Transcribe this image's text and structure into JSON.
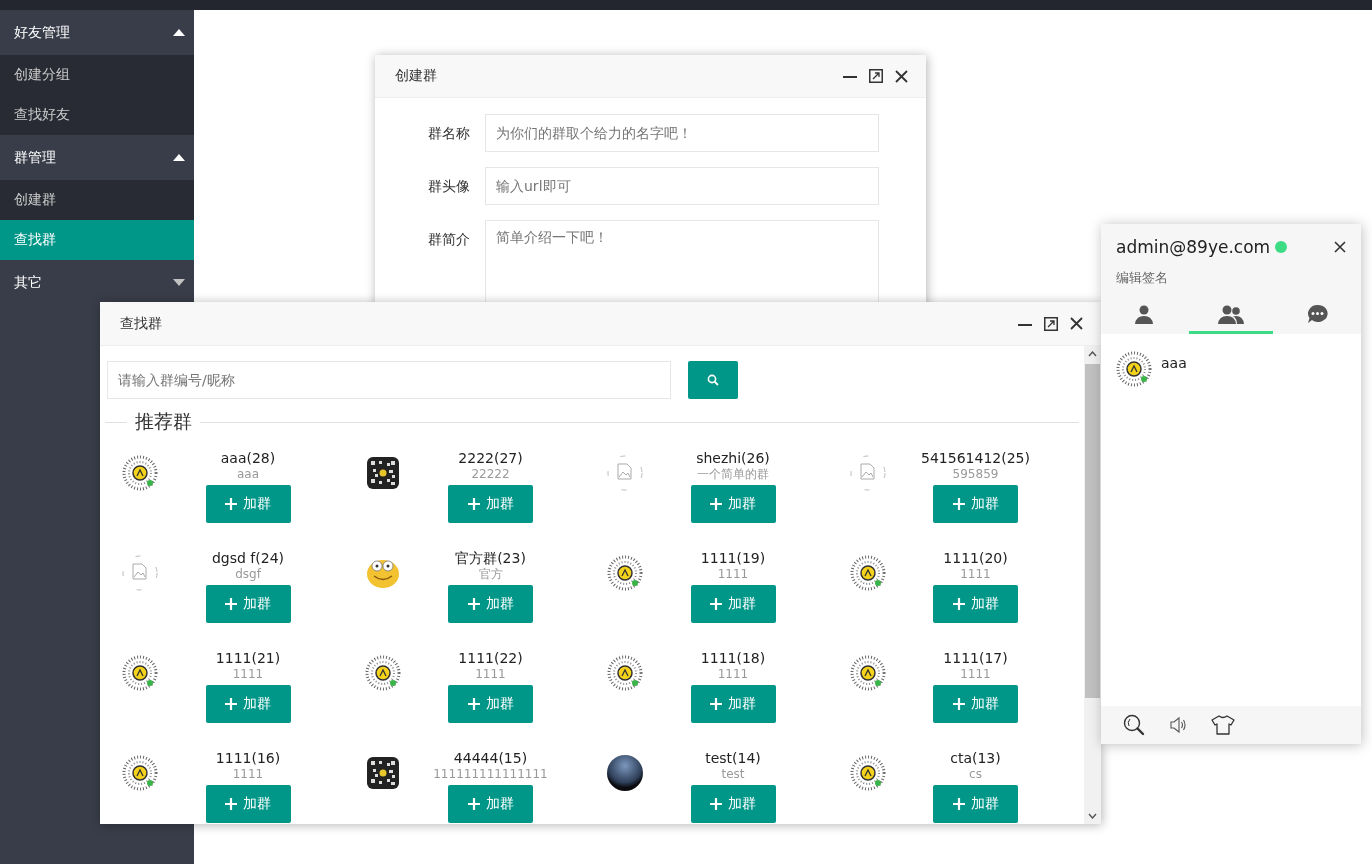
{
  "sidebar": {
    "groups": [
      {
        "label": "好友管理",
        "expanded": true,
        "items": [
          {
            "label": "创建分组",
            "selected": false
          },
          {
            "label": "查找好友",
            "selected": false
          }
        ]
      },
      {
        "label": "群管理",
        "expanded": true,
        "items": [
          {
            "label": "创建群",
            "selected": false
          },
          {
            "label": "查找群",
            "selected": true
          }
        ]
      },
      {
        "label": "其它",
        "expanded": false
      }
    ]
  },
  "create_group_window": {
    "title": "创建群",
    "fields": [
      {
        "label": "群名称",
        "placeholder": "为你们的群取个给力的名字吧！",
        "kind": "input"
      },
      {
        "label": "群头像",
        "placeholder": "输入url即可",
        "kind": "input"
      },
      {
        "label": "群简介",
        "placeholder": "简单介绍一下吧！",
        "kind": "textarea"
      }
    ]
  },
  "find_group_window": {
    "title": "查找群",
    "search": {
      "placeholder": "请输入群编号/昵称"
    },
    "section_title": "推荐群",
    "groups": [
      {
        "name": "aaa(28)",
        "description": "aaa",
        "kind": "qrbell",
        "button": "加群"
      },
      {
        "name": "2222(27)",
        "description": "22222",
        "kind": "qr",
        "button": "加群"
      },
      {
        "name": "shezhi(26)",
        "description": "一个简单的群",
        "kind": "broken",
        "button": "加群"
      },
      {
        "name": "541561412(25)",
        "description": "595859",
        "kind": "broken",
        "button": "加群"
      },
      {
        "name": "dgsd f(24)",
        "description": "dsgf",
        "kind": "broken",
        "button": "加群"
      },
      {
        "name": "官方群(23)",
        "description": "官方",
        "kind": "cartoon",
        "button": "加群"
      },
      {
        "name": "1111(19)",
        "description": "1111",
        "kind": "qrbell",
        "button": "加群"
      },
      {
        "name": "1111(20)",
        "description": "1111",
        "kind": "qrbell",
        "button": "加群"
      },
      {
        "name": "1111(21)",
        "description": "1111",
        "kind": "qrbell",
        "button": "加群"
      },
      {
        "name": "1111(22)",
        "description": "1111",
        "kind": "qrbell",
        "button": "加群"
      },
      {
        "name": "1111(18)",
        "description": "1111",
        "kind": "qrbell",
        "button": "加群"
      },
      {
        "name": "1111(17)",
        "description": "1111",
        "kind": "qrbell",
        "button": "加群"
      },
      {
        "name": "1111(16)",
        "description": "1111",
        "kind": "qrbell",
        "button": "加群"
      },
      {
        "name": "44444(15)",
        "description": "111111111111111",
        "kind": "qr",
        "button": "加群"
      },
      {
        "name": "test(14)",
        "description": "test",
        "kind": "photo",
        "button": "加群"
      },
      {
        "name": "cta(13)",
        "description": "cs",
        "kind": "qrbell",
        "button": "加群"
      }
    ]
  },
  "chat_panel": {
    "username": "admin@89ye.com",
    "online": true,
    "signature": "编辑签名",
    "tabs": [
      {
        "kind": "friends",
        "selected": false
      },
      {
        "kind": "groups",
        "selected": true
      },
      {
        "kind": "history",
        "selected": false
      }
    ],
    "groups": [
      {
        "name": "aaa",
        "kind": "qrbell"
      }
    ]
  }
}
